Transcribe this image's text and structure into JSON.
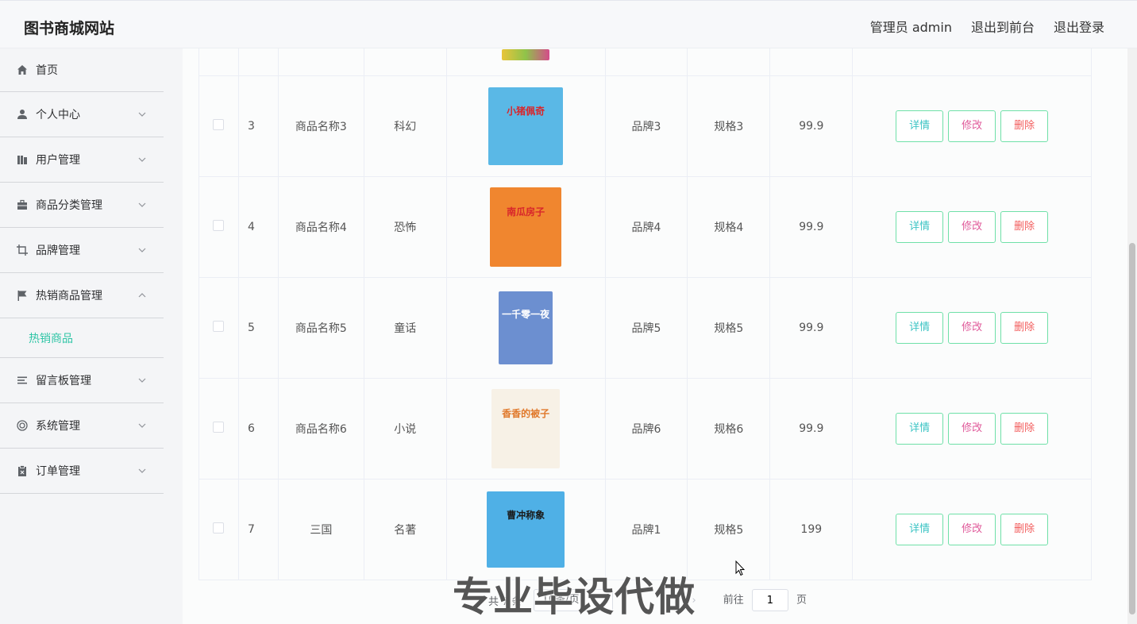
{
  "header": {
    "brand": "图书商城网站",
    "admin_label": "管理员 admin",
    "to_front_label": "退出到前台",
    "logout_label": "退出登录"
  },
  "sidebar": {
    "items": [
      {
        "label": "首页",
        "icon": "home-icon"
      },
      {
        "label": "个人中心",
        "icon": "user-icon"
      },
      {
        "label": "用户管理",
        "icon": "users-icon"
      },
      {
        "label": "商品分类管理",
        "icon": "briefcase-icon"
      },
      {
        "label": "品牌管理",
        "icon": "crop-icon"
      },
      {
        "label": "热销商品管理",
        "icon": "flag-icon",
        "expanded": true
      },
      {
        "label": "留言板管理",
        "icon": "list-icon"
      },
      {
        "label": "系统管理",
        "icon": "settings-icon"
      },
      {
        "label": "订单管理",
        "icon": "clipboard-icon"
      }
    ],
    "sub_active": "热销商品",
    "accent_color": "#2fc5a6"
  },
  "table": {
    "rows": [
      {
        "index": "3",
        "name": "商品名称3",
        "category": "科幻",
        "brand": "品牌3",
        "spec": "规格3",
        "price": "99.9",
        "cover_title": "小猪佩奇",
        "cover_color": "#5ab8e6"
      },
      {
        "index": "4",
        "name": "商品名称4",
        "category": "恐怖",
        "brand": "品牌4",
        "spec": "规格4",
        "price": "99.9",
        "cover_title": "南瓜房子",
        "cover_color": "#f0862f"
      },
      {
        "index": "5",
        "name": "商品名称5",
        "category": "童话",
        "brand": "品牌5",
        "spec": "规格5",
        "price": "99.9",
        "cover_title": "一千零一夜",
        "cover_color": "#6c8fd0"
      },
      {
        "index": "6",
        "name": "商品名称6",
        "category": "小说",
        "brand": "品牌6",
        "spec": "规格6",
        "price": "99.9",
        "cover_title": "香香的被子",
        "cover_color": "#f7f1e6"
      },
      {
        "index": "7",
        "name": "三国",
        "category": "名著",
        "brand": "品牌1",
        "spec": "规格5",
        "price": "199",
        "cover_title": "曹冲称象",
        "cover_color": "#4fb0e6"
      }
    ],
    "actions": {
      "detail": "详情",
      "edit": "修改",
      "delete": "删除"
    }
  },
  "pagination": {
    "total_label": "共 7 条",
    "page_size": "10条/页",
    "goto_label": "前往",
    "goto_value": "1",
    "page_unit": "页"
  },
  "watermark": "专业毕设代做"
}
